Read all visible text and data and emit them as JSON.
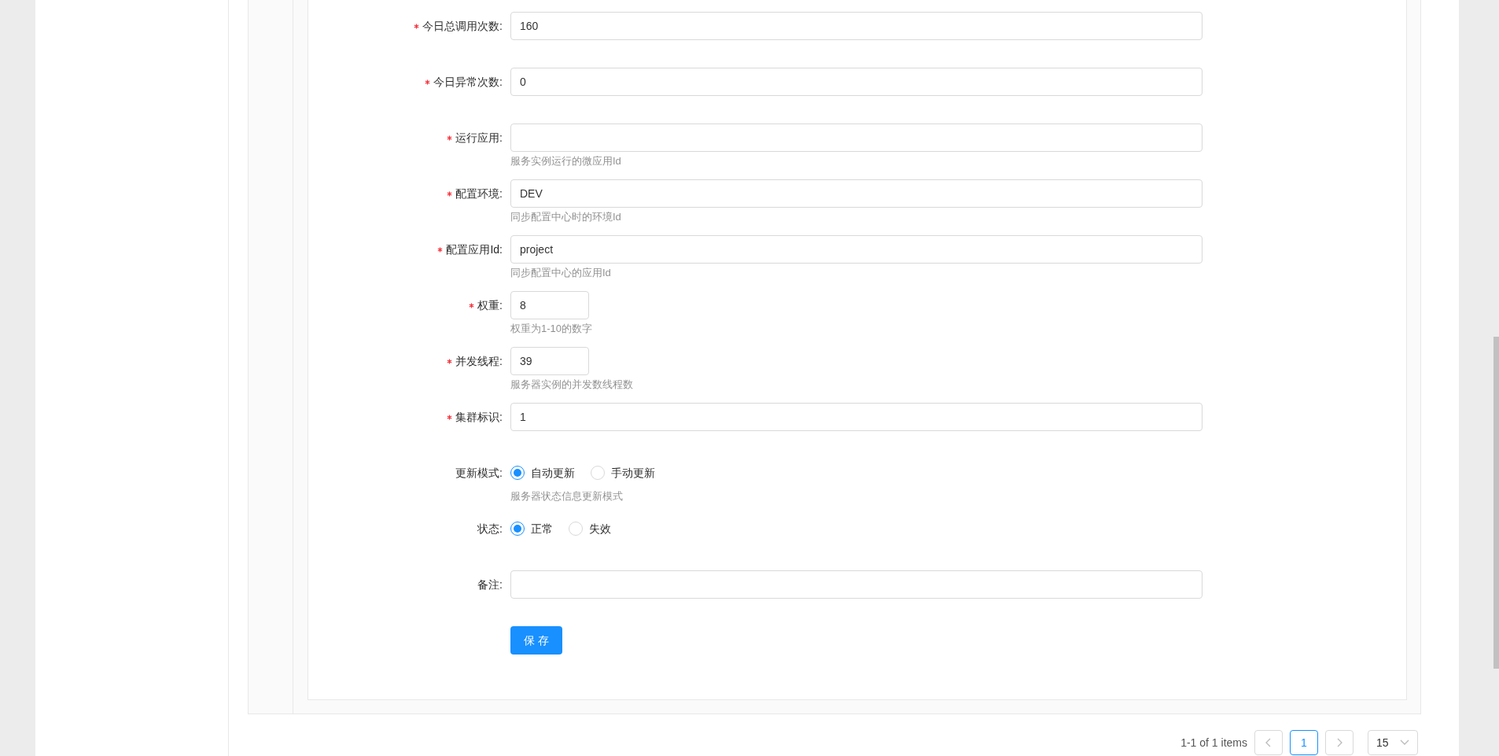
{
  "form": {
    "fields": [
      {
        "kind": "text",
        "label": "今日总调用次数:",
        "required": true,
        "value": "160"
      },
      {
        "kind": "text",
        "label": "今日异常次数:",
        "required": true,
        "value": "0"
      },
      {
        "kind": "text",
        "label": "运行应用:",
        "required": true,
        "help": "服务实例运行的微应用Id"
      },
      {
        "kind": "text",
        "label": "配置环境:",
        "required": true,
        "value": "DEV",
        "help": "同步配置中心时的环境Id"
      },
      {
        "kind": "text",
        "label": "配置应用Id:",
        "required": true,
        "value": "project",
        "help": "同步配置中心的应用Id"
      },
      {
        "kind": "short",
        "label": "权重:",
        "required": true,
        "value": "8",
        "help": "权重为1-10的数字"
      },
      {
        "kind": "short",
        "label": "并发线程:",
        "required": true,
        "value": "39",
        "help": "服务器实例的并发数线程数"
      },
      {
        "kind": "text",
        "label": "集群标识:",
        "required": true,
        "value": "1"
      },
      {
        "kind": "radio",
        "label": "更新模式:",
        "required": false,
        "options": [
          {
            "label": "自动更新",
            "selected": true
          },
          {
            "label": "手动更新",
            "selected": false
          }
        ],
        "help": "服务器状态信息更新模式"
      },
      {
        "kind": "radio",
        "label": "状态:",
        "required": false,
        "options": [
          {
            "label": "正常",
            "selected": true
          },
          {
            "label": "失效",
            "selected": false
          }
        ]
      },
      {
        "kind": "text",
        "label": "备注:",
        "required": false
      }
    ],
    "save_button": "保 存"
  },
  "pagination": {
    "summary": "1-1 of 1 items",
    "pages": [
      {
        "label": "1",
        "selected": true
      }
    ],
    "page_size": "15"
  }
}
